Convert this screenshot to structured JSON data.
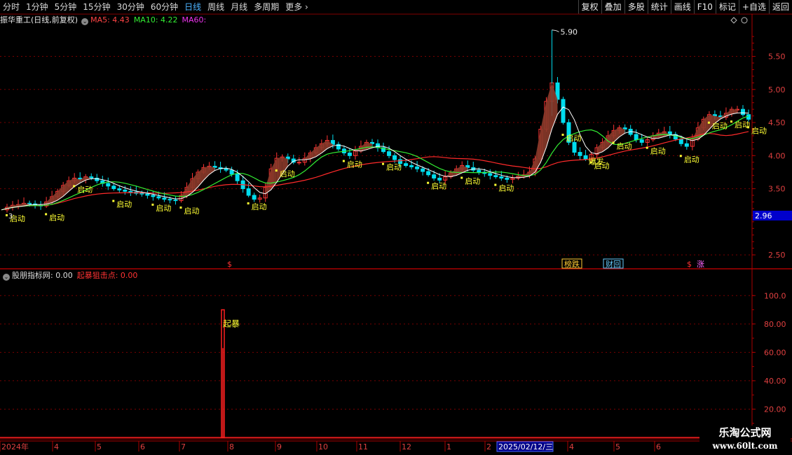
{
  "toolbar": {
    "periods": [
      {
        "label": "分时",
        "active": false
      },
      {
        "label": "1分钟",
        "active": false
      },
      {
        "label": "5分钟",
        "active": false
      },
      {
        "label": "15分钟",
        "active": false
      },
      {
        "label": "30分钟",
        "active": false
      },
      {
        "label": "60分钟",
        "active": false
      },
      {
        "label": "日线",
        "active": true
      },
      {
        "label": "周线",
        "active": false
      },
      {
        "label": "月线",
        "active": false
      },
      {
        "label": "多周期",
        "active": false
      },
      {
        "label": "更多",
        "active": false
      }
    ],
    "buttons": [
      "复权",
      "叠加",
      "多股",
      "统计",
      "画线",
      "F10",
      "标记",
      "+自选",
      "返回"
    ]
  },
  "price_panel": {
    "title": "振华重工(日线,前复权)",
    "ma5_label": "MA5: 4.43",
    "ma10_label": "MA10: 4.22",
    "ma60_label": "MA60:",
    "high_label": "5.90",
    "low_label": "3.",
    "current_price": "2.96",
    "y_ticks": [
      "5.50",
      "5.00",
      "4.50",
      "4.00",
      "3.50",
      "2.50"
    ],
    "signal_label": "启动",
    "burst_label": "爆发",
    "event_markers": [
      "$",
      "榜跌",
      "财回",
      "$",
      "涨"
    ]
  },
  "indicator_panel": {
    "name": "股朋指标网",
    "name_value": ": 0.00",
    "signal_name": "起暴狙击点",
    "signal_value": ": 0.00",
    "spike_label": "起暴",
    "y_ticks": [
      "100.0",
      "80.00",
      "60.00",
      "40.00",
      "20.00"
    ],
    "spike_value": 90
  },
  "x_axis": {
    "labels": [
      "2024年",
      "4",
      "5",
      "6",
      "7",
      "8",
      "9",
      "10",
      "11",
      "12",
      "1",
      "2",
      "4",
      "5",
      "6"
    ],
    "cursor_date": "2025/02/12/三"
  },
  "watermark": {
    "line1": "乐淘公式网",
    "line2": "www.60lt.com"
  },
  "colors": {
    "up": "#ff3333",
    "down": "#00ddee",
    "ma5": "#ff4444",
    "ma10": "#33ee33",
    "ma60": "#ee33ee",
    "signal": "#ffff33",
    "grid": "#7a0000"
  },
  "chart_data": {
    "type": "candlestick",
    "price_axis": {
      "min": 2.3,
      "max": 5.95,
      "ticks": [
        2.5,
        3.5,
        4.0,
        4.5,
        5.0,
        5.5
      ]
    },
    "close": [
      3.18,
      3.22,
      3.25,
      3.26,
      3.28,
      3.27,
      3.25,
      3.24,
      3.3,
      3.38,
      3.46,
      3.55,
      3.62,
      3.66,
      3.64,
      3.68,
      3.66,
      3.62,
      3.58,
      3.54,
      3.5,
      3.48,
      3.46,
      3.45,
      3.43,
      3.42,
      3.4,
      3.38,
      3.36,
      3.34,
      3.33,
      3.32,
      3.4,
      3.52,
      3.65,
      3.75,
      3.82,
      3.84,
      3.82,
      3.8,
      3.78,
      3.72,
      3.62,
      3.5,
      3.4,
      3.34,
      3.36,
      3.52,
      3.8,
      3.96,
      3.98,
      3.95,
      3.9,
      3.9,
      3.96,
      4.04,
      4.12,
      4.18,
      4.23,
      4.17,
      4.1,
      4.04,
      4.0,
      4.07,
      4.14,
      4.2,
      4.18,
      4.12,
      4.06,
      4.0,
      3.94,
      3.88,
      3.85,
      3.83,
      3.8,
      3.76,
      3.71,
      3.66,
      3.63,
      3.68,
      3.74,
      3.8,
      3.85,
      3.82,
      3.78,
      3.75,
      3.73,
      3.7,
      3.68,
      3.66,
      3.64,
      3.66,
      3.69,
      3.71,
      3.75,
      3.95,
      4.4,
      4.82,
      5.1,
      4.85,
      4.5,
      4.2,
      4.05,
      4.0,
      3.95,
      4.02,
      4.12,
      4.2,
      4.3,
      4.38,
      4.42,
      4.4,
      4.32,
      4.24,
      4.2,
      4.24,
      4.3,
      4.34,
      4.36,
      4.32,
      4.25,
      4.18,
      4.14,
      4.25,
      4.42,
      4.55,
      4.62,
      4.6,
      4.58,
      4.64,
      4.7,
      4.7,
      4.62,
      4.55
    ],
    "signals": [
      "启动",
      "启动",
      "启动",
      "启动",
      "启动",
      "启动",
      "启动",
      "启动",
      "启动",
      "启动",
      "启动",
      "启动",
      "启动",
      "启动",
      "启动",
      "启动",
      "启动",
      "启动",
      "启动",
      "启动",
      "启动"
    ],
    "indicator": {
      "series": "起暴狙击点",
      "spike_value": 90,
      "axis_min": 0,
      "axis_max": 110
    }
  }
}
